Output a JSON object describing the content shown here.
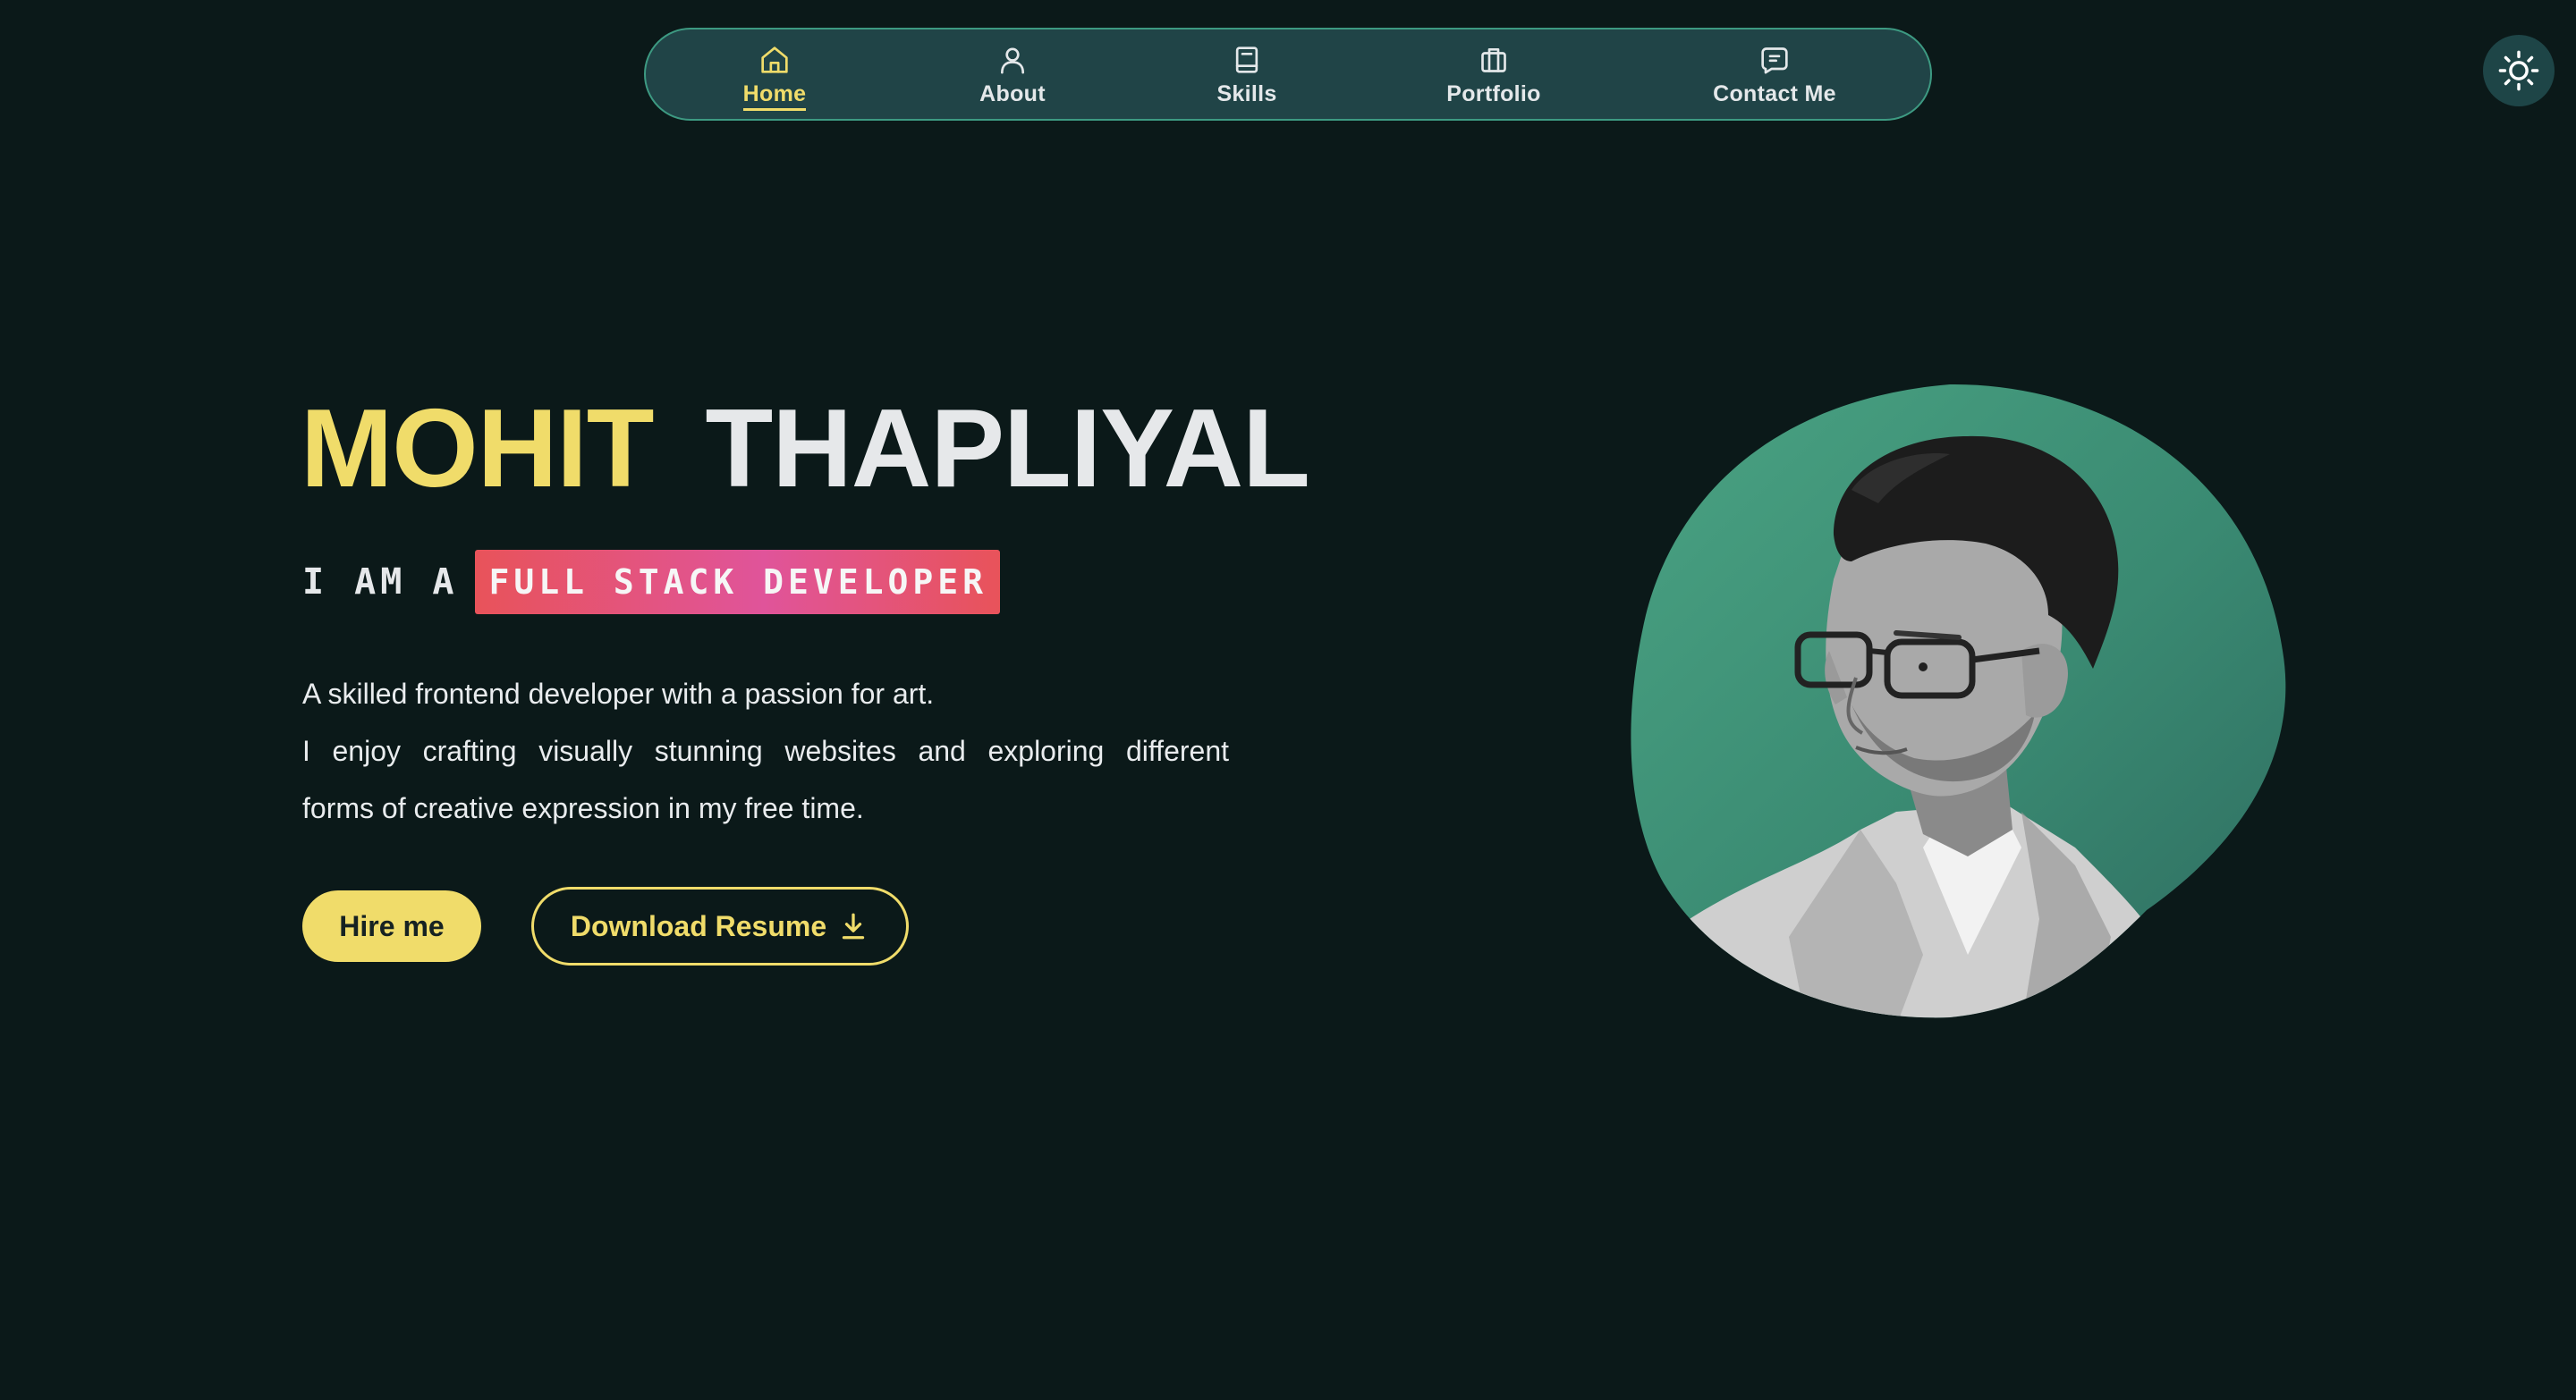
{
  "nav": {
    "items": [
      {
        "label": "Home",
        "icon": "home-icon",
        "active": true
      },
      {
        "label": "About",
        "icon": "user-icon",
        "active": false
      },
      {
        "label": "Skills",
        "icon": "book-icon",
        "active": false
      },
      {
        "label": "Portfolio",
        "icon": "briefcase-icon",
        "active": false
      },
      {
        "label": "Contact Me",
        "icon": "message-icon",
        "active": false
      }
    ]
  },
  "theme_toggle": {
    "icon": "sun-icon"
  },
  "hero": {
    "first_name": "MOHIT",
    "last_name": "THAPLIYAL",
    "role_prefix": "I AM A",
    "role": "FULL STACK DEVELOPER",
    "intro_line1": "A skilled frontend developer with a passion for art.",
    "intro_line2": "I enjoy crafting visually stunning websites and exploring different",
    "intro_line3": "forms of creative expression in my free time.",
    "hire_label": "Hire me",
    "resume_label": "Download Resume",
    "resume_icon": "download-icon",
    "portrait_icon": "profile-photo"
  },
  "colors": {
    "background": "#0b1919",
    "accent_yellow": "#f0dc6a",
    "nav_background": "#204447",
    "nav_border": "#3d9a82",
    "role_gradient_start": "#e8535a",
    "role_gradient_mid": "#e0549a",
    "portrait_green": "#3f9679"
  }
}
